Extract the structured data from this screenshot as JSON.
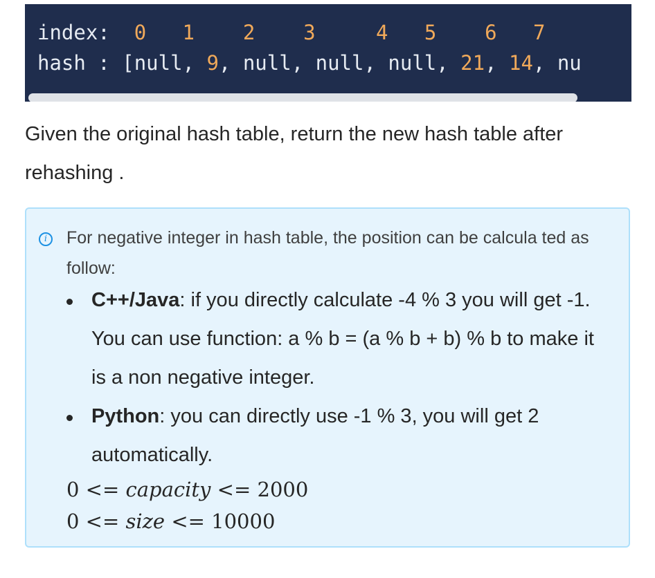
{
  "code": {
    "index_label": "index:",
    "index_values": [
      "0",
      "1",
      "2",
      "3",
      "4",
      "5",
      "6",
      "7"
    ],
    "hash_label": "hash :",
    "hash_values": [
      "null",
      "9",
      "null",
      "null",
      "null",
      "21",
      "14",
      "nu"
    ]
  },
  "paragraph": "Given the original hash table, return the new hash table after rehashing .",
  "info": {
    "icon": "info-circle-icon",
    "note": "For negative integer in hash table, the position can be calcula ted as follow:",
    "bullets": [
      {
        "bold": "C++/Java",
        "text": ": if you directly calculate -4 % 3 you will get -1. You can use function: a % b = (a % b + b) % b to make it is a non negative integer."
      },
      {
        "bold": "Python",
        "text": ": you can directly use -1 % 3, you will get 2 automatically."
      }
    ],
    "constraints": [
      {
        "lhs": "0 <=",
        "var": "capacity",
        "rhs": "<= 2000"
      },
      {
        "lhs": "0 <=",
        "var": "size",
        "rhs": "<= 10000"
      }
    ]
  }
}
